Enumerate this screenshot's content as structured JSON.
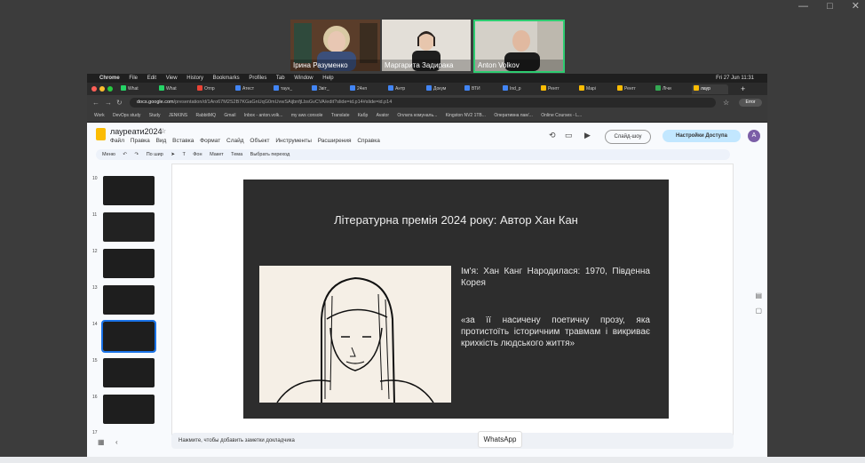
{
  "window_controls": [
    "—",
    "□",
    "✕"
  ],
  "participants": [
    {
      "name": "Ірина Разуменко"
    },
    {
      "name": "Маргарита Задирака"
    },
    {
      "name": "Anton Volkov"
    }
  ],
  "mac_menubar": {
    "apple": "",
    "items": [
      "Chrome",
      "File",
      "Edit",
      "View",
      "History",
      "Bookmarks",
      "Profiles",
      "Tab",
      "Window",
      "Help"
    ],
    "datetime": "Fri 27 Jun 11:31"
  },
  "browser": {
    "tabs": [
      {
        "label": "What",
        "color": "#25d366"
      },
      {
        "label": "What",
        "color": "#25d366"
      },
      {
        "label": "Отпр",
        "color": "#ea4335"
      },
      {
        "label": "Атест",
        "color": "#4285f4"
      },
      {
        "label": "таун_",
        "color": "#4285f4"
      },
      {
        "label": "3віт_",
        "color": "#4285f4"
      },
      {
        "label": "24нп",
        "color": "#4285f4"
      },
      {
        "label": "Антр",
        "color": "#4285f4"
      },
      {
        "label": "Докум",
        "color": "#4285f4"
      },
      {
        "label": "ВТИ",
        "color": "#4285f4"
      },
      {
        "label": "Ind_p",
        "color": "#4285f4"
      },
      {
        "label": "Рентг",
        "color": "#fbbc04"
      },
      {
        "label": "Марі",
        "color": "#fbbc04"
      },
      {
        "label": "Рентг",
        "color": "#fbbc04"
      },
      {
        "label": "Лічи",
        "color": "#34a853"
      },
      {
        "label": "лаур",
        "color": "#fbbc04"
      }
    ],
    "new_tab": "+",
    "url_host": "docs.google.com",
    "url_path": "/presentation/d/1Aro67M2S2B7KGaGnUqG0mUvwSAijbnfjLbsGvCVA/edit?slide=id.p14#slide=id.p14",
    "profile_label": "Error",
    "bookmarks": [
      "Work",
      "DevOps study",
      "Study",
      "JENKINS",
      "RabbitMQ",
      "Gmail",
      "Inbox - anton.volk...",
      "my aws console",
      "Translate",
      "Кабр",
      "Avator",
      "Оплата комуналь...",
      "Kingston NV2 1TB...",
      "Оперативна пам'...",
      "Online Courses - L..."
    ]
  },
  "slides_app": {
    "doc_title": "лауреати2024",
    "menus": [
      "Файл",
      "Правка",
      "Вид",
      "Вставка",
      "Формат",
      "Слайд",
      "Объект",
      "Инструменты",
      "Расширения",
      "Справка"
    ],
    "slideshow_button": "Слайд-шоу",
    "share_button": "Настройки Доступа",
    "avatar_letter": "A",
    "toolbar": {
      "search": "Меню",
      "zoom": "По шир",
      "items": [
        "Фон",
        "Макет",
        "Тема",
        "Выбрать переход"
      ]
    },
    "filmstrip": [
      {
        "num": "10"
      },
      {
        "num": "11"
      },
      {
        "num": "12"
      },
      {
        "num": "13"
      },
      {
        "num": "14",
        "selected": true
      },
      {
        "num": "15"
      },
      {
        "num": "16"
      },
      {
        "num": "17"
      }
    ],
    "notes_placeholder": "Нажмите, чтобы добавить заметки докладчика"
  },
  "slide": {
    "title": "Літературна премія 2024 року: Автор Хан Кан",
    "info": "Ім'я: Хан Канг Народилася: 1970, Південна Корея",
    "quote": "«за її насичену поетичну прозу, яка протистоїть історичним травмам і викриває крихкість людського життя»"
  },
  "tooltip": "WhatsApp"
}
